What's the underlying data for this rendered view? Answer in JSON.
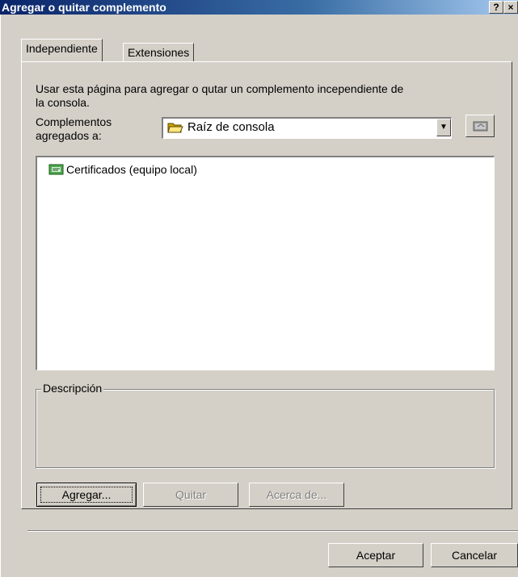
{
  "window": {
    "title": "Agregar o quitar complemento",
    "help_button": "?",
    "close_button": "×"
  },
  "tabs": [
    {
      "label": "Independiente",
      "active": true
    },
    {
      "label": "Extensiones",
      "active": false
    }
  ],
  "panel": {
    "description_line1": "Usar esta página para agregar o qutar un complemento incependiente de",
    "description_line2": "la consola.",
    "snapins_label_line1": "Complementos",
    "snapins_label_line2": "agregados a:",
    "combo_value": "Raíz de consola",
    "list_items": [
      {
        "label": "Certificados (equipo local)",
        "icon": "certificate-snapin-icon"
      }
    ],
    "description_group_label": "Descripción",
    "buttons": {
      "add": "Agregar...",
      "remove": "Quitar",
      "about": "Acerca de..."
    }
  },
  "footer": {
    "ok": "Aceptar",
    "cancel": "Cancelar"
  }
}
